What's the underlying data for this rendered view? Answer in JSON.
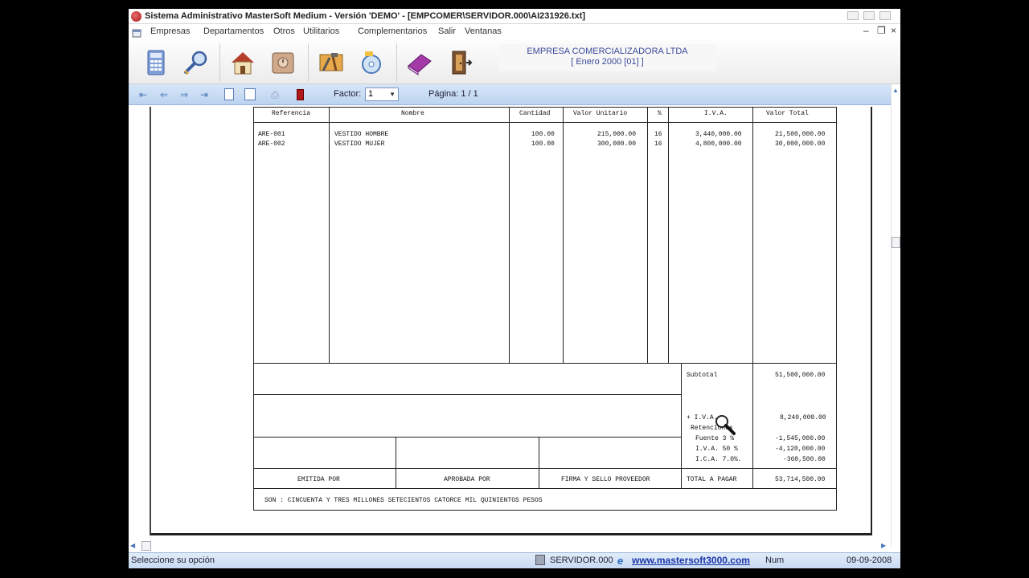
{
  "titlebar": {
    "title": "Sistema Administrativo MasterSoft Medium    -   Versión 'DEMO' - [EMPCOMER\\SERVIDOR.000\\AI231926.txt]"
  },
  "menu": {
    "items": [
      "Empresas",
      "Departamentos",
      "Otros",
      "Utilitarios",
      "Complementarios",
      "Salir",
      "Ventanas"
    ]
  },
  "toolbar": {
    "icons": [
      "calculator-icon",
      "search-key-icon",
      "home-icon",
      "safe-icon",
      "tools-icon",
      "cd-icon",
      "book-icon",
      "exit-door-icon"
    ]
  },
  "company": {
    "name": "EMPRESA COMERCIALIZADORA LTDA",
    "period": "[ Enero     2000 [01] ]"
  },
  "nav": {
    "factor_label": "Factor:",
    "factor_value": "1",
    "page_label": "Página: 1 / 1"
  },
  "invoice": {
    "headers": [
      "Referencia",
      "Nombre",
      "Cantidad",
      "Valor Unitario",
      "%",
      "I.V.A.",
      "Valor Total"
    ],
    "rows": [
      [
        "ARE-001",
        "VESTIDO HOMBRE",
        "100.00",
        "215,000.00",
        "16",
        "3,440,000.00",
        "21,500,000.00"
      ],
      [
        "ARE-002",
        "VESTIDO MUJER",
        "100.00",
        "300,000.00",
        "16",
        "4,800,000.00",
        "30,000,000.00"
      ]
    ],
    "subtotal_label": "Subtotal",
    "subtotal_value": "51,500,000.00",
    "iva_label": "+ I.V.A.",
    "iva_value": "8,240,000.00",
    "retenciones_label": "Retenciones",
    "ret_fuente_label": "Fuente   3 %",
    "ret_fuente_value": "-1,545,000.00",
    "ret_iva_label": "I.V.A.   50 %",
    "ret_iva_value": "-4,120,000.00",
    "ret_ica_label": "I.C.A.   7.0%.",
    "ret_ica_value": "-360,500.00",
    "emitida": "EMITIDA POR",
    "aprobada": "APROBADA POR",
    "firma": "FIRMA Y SELLO PROVEEDOR",
    "total_label": "TOTAL A PAGAR",
    "total_value": "53,714,500.00",
    "son": "SON :  CINCUENTA Y TRES MILLONES SETECIENTOS CATORCE MIL QUINIENTOS PESOS"
  },
  "status": {
    "hint": "Seleccione su opción",
    "server": "SERVIDOR.000",
    "url": "www.mastersoft3000.com",
    "num": "Num",
    "date": "09-09-2008"
  }
}
